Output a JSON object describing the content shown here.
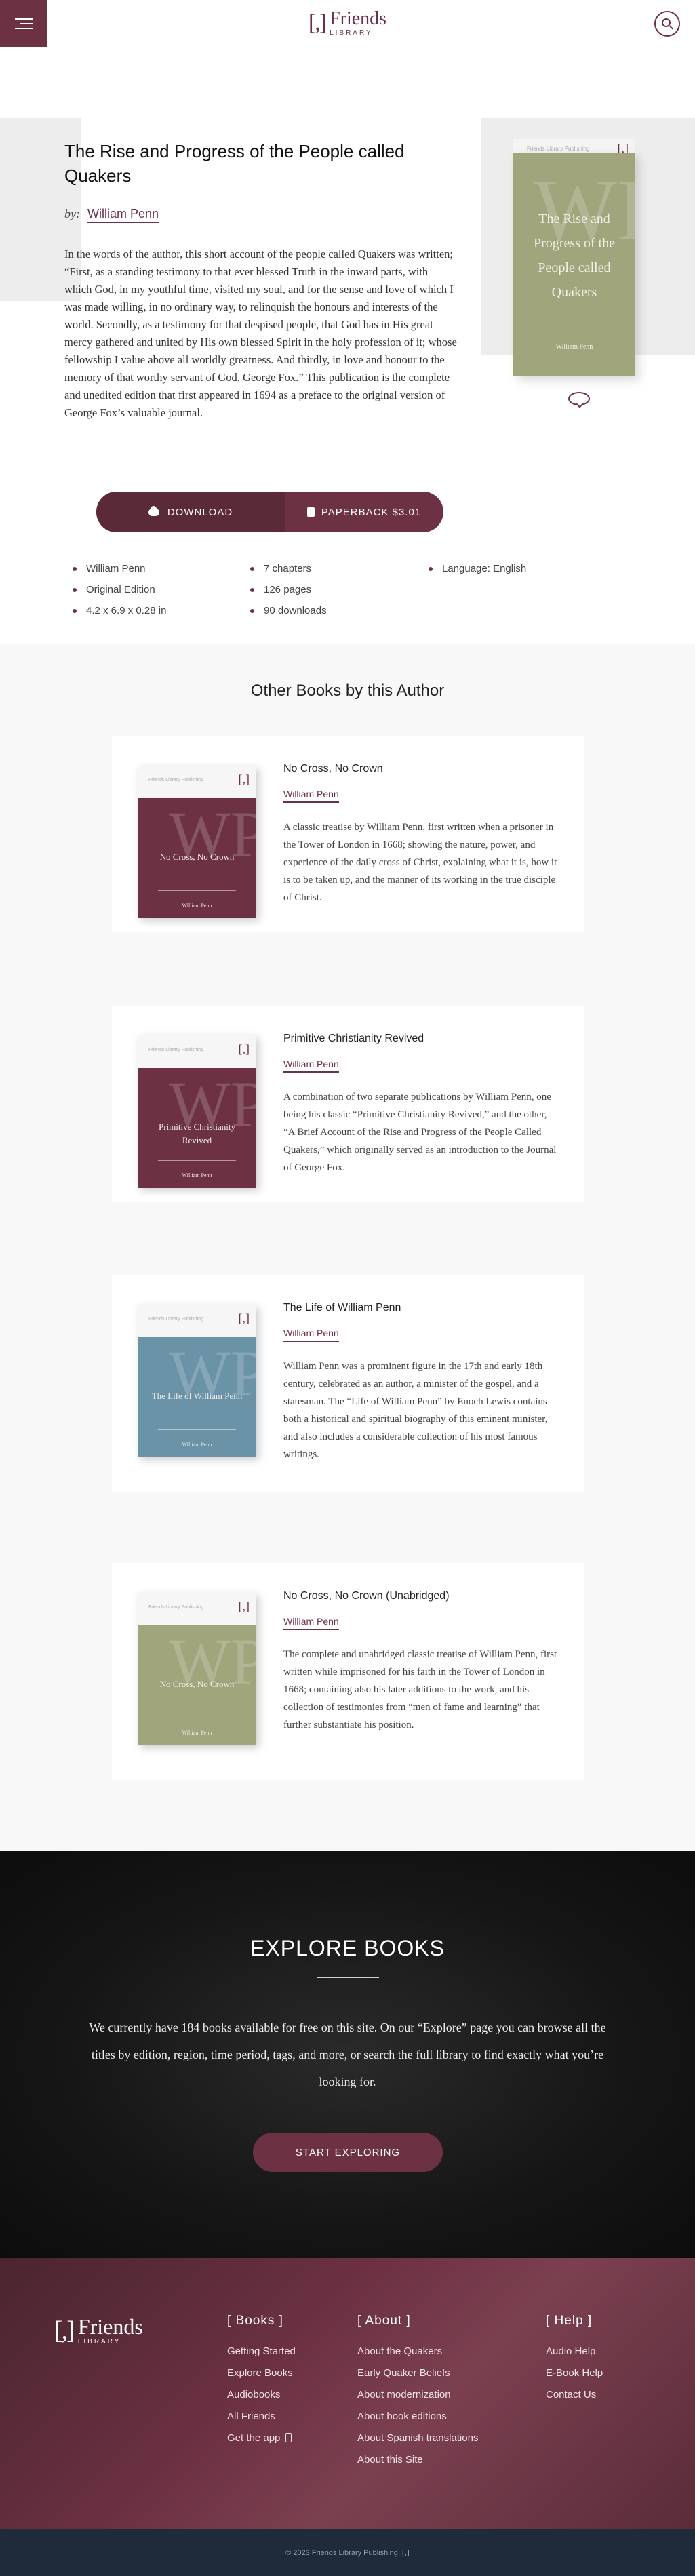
{
  "nav": {
    "logo_mark": "[,]",
    "logo_text": "Friends",
    "logo_sub": "LIBRARY"
  },
  "book": {
    "title": "The Rise and Progress of the People called Quakers",
    "by_label": "by:",
    "author": "William Penn",
    "description": "In the words of the author, this short account of the people called Quakers was written; “First, as a standing testimony to that ever blessed Truth in the inward parts, with which God, in my youthful time, visited my soul, and for the sense and love of which I was made willing, in no ordinary way, to relinquish the honours and interests of the world. Secondly, as a testimony for that despised people, that God has in His great mercy gathered and united by His own blessed Spirit in the holy profession of it; whose fellowship I value above all worldly greatness. And thirdly, in love and honour to the memory of that worthy servant of God, George Fox.” This publication is the complete and unedited edition that first appeared in 1694 as a preface to the original version of George Fox’s valuable journal.",
    "cover": {
      "publisher": "Friends Library Publishing",
      "logo": "[,]",
      "watermark": "WP",
      "lines": [
        "The Rise and",
        "Progress of the",
        "People called",
        "Quakers"
      ],
      "author": "William Penn",
      "color": "#a0a57c"
    },
    "download_label": "DOWNLOAD",
    "paperback_label": "PAPERBACK $3.01",
    "meta": {
      "col1": [
        "William Penn",
        "Original Edition",
        "4.2 x 6.9 x 0.28 in"
      ],
      "col2": [
        "7 chapters",
        "126 pages",
        "90 downloads"
      ],
      "col3": [
        "Language: English"
      ]
    }
  },
  "others": {
    "heading": "Other Books by this Author",
    "books": [
      {
        "title": "No Cross, No Crown",
        "author": "William Penn",
        "cover_lines": "No Cross, No Crown",
        "cover_color": "#6c3142",
        "description": "A classic treatise by William Penn, first written when a prisoner in the Tower of London in 1668; showing the nature, power, and experience of the daily cross of Christ, explaining what it is, how it is to be taken up, and the manner of its working in the true disciple of Christ."
      },
      {
        "title": "Primitive Christianity Revived",
        "author": "William Penn",
        "cover_lines": "Primitive Christianity Revived",
        "cover_color": "#6c3142",
        "description": "A combination of two separate publications by William Penn, one being his classic “Primitive Christianity Revived,” and the other, “A Brief Account of the Rise and Progress of the People Called Quakers,” which originally served as an introduction to the Journal of George Fox."
      },
      {
        "title": "The Life of William Penn",
        "author": "William Penn",
        "cover_lines": "The Life of William Penn",
        "cover_color": "#6a93a8",
        "description": "William Penn was a prominent figure in the 17th and early 18th century, celebrated as an author, a minister of the gospel, and a statesman. The “Life of William Penn” by Enoch Lewis contains both a historical and spiritual biography of this eminent minister, and also includes a considerable collection of his most famous writings."
      },
      {
        "title": "No Cross, No Crown (Unabridged)",
        "author": "William Penn",
        "cover_lines": "No Cross, No Crown",
        "cover_color": "#a0a57c",
        "description": "The complete and unabridged classic treatise of William Penn, first written while imprisoned for his faith in the Tower of London in 1668; containing also his later additions to the work, and his collection of testimonies from “men of fame and learning” that further substantiate his position."
      }
    ]
  },
  "explore": {
    "heading": "EXPLORE BOOKS",
    "text": "We currently have 184 books available for free on this site. On our “Explore” page you can browse all the titles by edition, region, time period, tags, and more, or search the full library to find exactly what you’re looking for.",
    "cta": "START EXPLORING"
  },
  "footer": {
    "logo_mark": "[,]",
    "logo_text": "Friends",
    "logo_sub": "LIBRARY",
    "cols": [
      {
        "heading": "[ Books ]",
        "items": [
          "Getting Started",
          "Explore Books",
          "Audiobooks",
          "All Friends",
          "Get the app"
        ]
      },
      {
        "heading": "[ About ]",
        "items": [
          "About the Quakers",
          "Early Quaker Beliefs",
          "About modernization",
          "About book editions",
          "About Spanish translations",
          "About this Site"
        ]
      },
      {
        "heading": "[ Help ]",
        "items": [
          "Audio Help",
          "E-Book Help",
          "Contact Us"
        ]
      }
    ],
    "copyright": "© 2023 Friends Library Publishing",
    "copyright_mark": "[,]"
  }
}
